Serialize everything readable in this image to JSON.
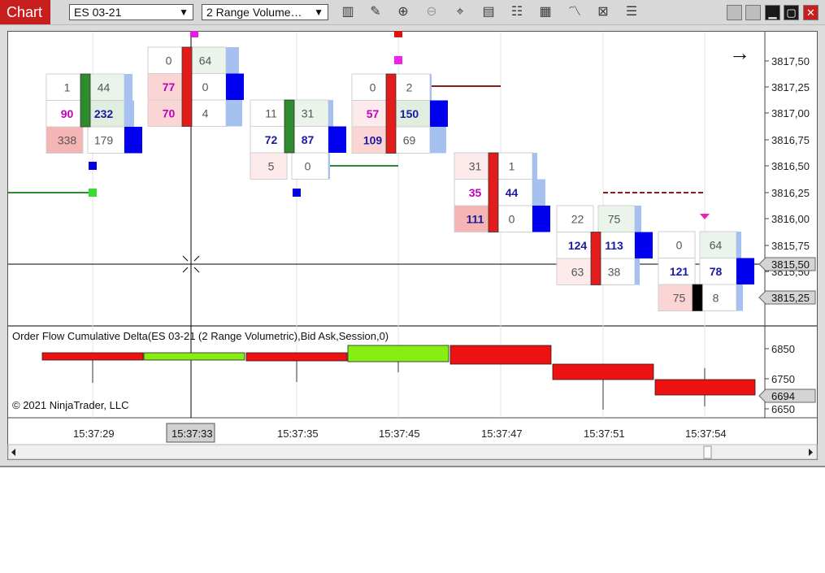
{
  "toolbar": {
    "tab_label": "Chart",
    "instrument": "ES 03-21",
    "bar_type": "2 Range Volume…",
    "icons": [
      "bar-type-icon",
      "pencil-icon",
      "zoom-in-icon",
      "zoom-out-icon",
      "crosshair-icon",
      "data-box-icon",
      "properties-icon",
      "strategies-icon",
      "indicators-icon",
      "templates-icon",
      "list-icon"
    ]
  },
  "window": {
    "buttons": [
      "tile-icon",
      "tile-icon",
      "minimize-icon",
      "maximize-icon",
      "close-icon"
    ]
  },
  "price_axis": {
    "labels": [
      "3817,50",
      "3817,25",
      "3817,00",
      "3816,75",
      "3816,50",
      "3816,25",
      "3816,00",
      "3815,75",
      "3815,50",
      "3815,25"
    ],
    "crosshair_label": "3815,50",
    "last_price_label": "3815,25"
  },
  "volumetric": {
    "colors": {
      "ask_text": "#1a1aa0",
      "bid_text": "#c000c0",
      "up_body": "#2e8b2e",
      "down_body": "#e21b1b",
      "doji_body": "#000000"
    },
    "bars": [
      {
        "time": "15:37:29",
        "rows": [
          {
            "bid": "1",
            "ask": "44"
          },
          {
            "bid": "90",
            "ask": "232"
          },
          {
            "bid": "338",
            "ask": "179"
          }
        ]
      },
      {
        "time": "15:37:33",
        "rows": [
          {
            "bid": "0",
            "ask": "64"
          },
          {
            "bid": "77",
            "ask": "0"
          },
          {
            "bid": "70",
            "ask": "4"
          }
        ]
      },
      {
        "time": "15:37:35",
        "rows": [
          {
            "bid": "11",
            "ask": "31"
          },
          {
            "bid": "72",
            "ask": "87"
          },
          {
            "bid": "5",
            "ask": "0"
          }
        ]
      },
      {
        "time": "15:37:45",
        "rows": [
          {
            "bid": "0",
            "ask": "2"
          },
          {
            "bid": "57",
            "ask": "150"
          },
          {
            "bid": "109",
            "ask": "69"
          }
        ]
      },
      {
        "time": "15:37:47",
        "rows": [
          {
            "bid": "31",
            "ask": "1"
          },
          {
            "bid": "35",
            "ask": "44"
          },
          {
            "bid": "111",
            "ask": "0"
          }
        ]
      },
      {
        "time": "15:37:51",
        "rows": [
          {
            "bid": "22",
            "ask": "75"
          },
          {
            "bid": "124",
            "ask": "113"
          },
          {
            "bid": "63",
            "ask": "38"
          }
        ]
      },
      {
        "time": "15:37:54",
        "rows": [
          {
            "bid": "0",
            "ask": "64"
          },
          {
            "bid": "121",
            "ask": "78"
          },
          {
            "bid": "75",
            "ask": "8"
          }
        ]
      }
    ]
  },
  "indicator": {
    "title": "Order Flow Cumulative Delta(ES 03-21 (2 Range Volumetric),Bid Ask,Session,0)",
    "axis_labels": [
      "6850",
      "6750",
      "6650"
    ],
    "last_value_label": "6694"
  },
  "copyright": "© 2021 NinjaTrader, LLC",
  "time_axis": {
    "labels": [
      "15:37:29",
      "15:37:33",
      "15:37:35",
      "15:37:45",
      "15:37:47",
      "15:37:51",
      "15:37:54"
    ],
    "crosshair_label": "15:37:33"
  },
  "nav": {
    "right_arrow_glyph": "→"
  }
}
